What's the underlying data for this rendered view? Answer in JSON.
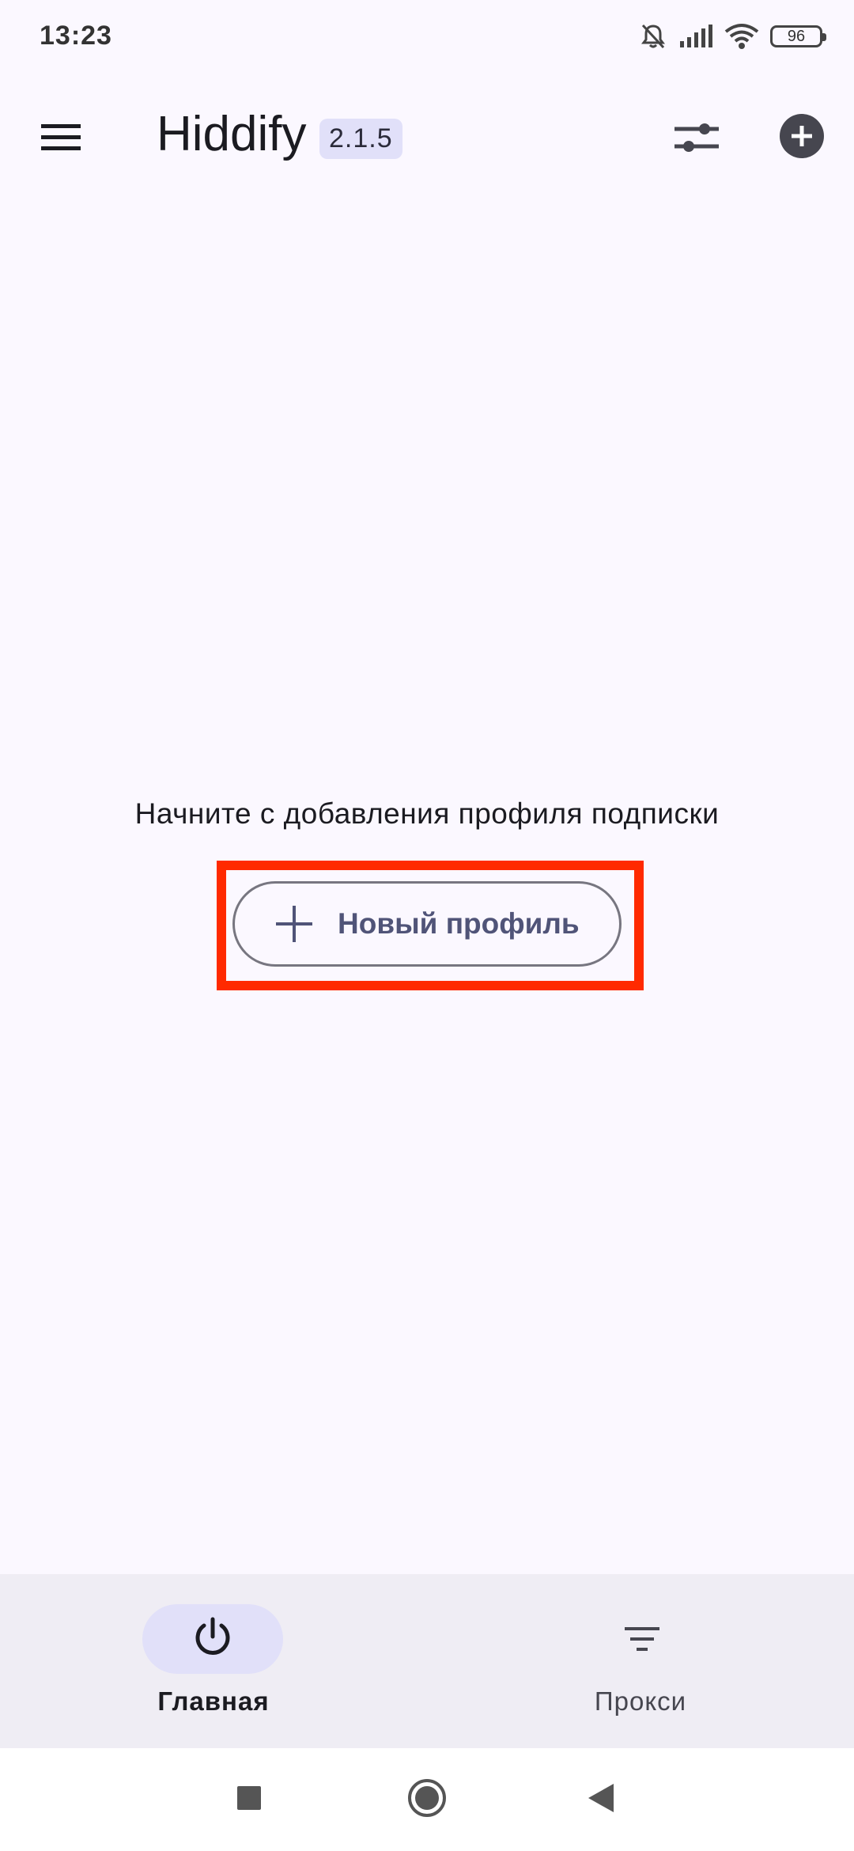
{
  "status_bar": {
    "time": "13:23",
    "battery": "96",
    "icons": [
      "bell-muted-icon",
      "signal-icon",
      "wifi-icon",
      "battery-icon"
    ]
  },
  "app_bar": {
    "title": "Hiddify",
    "version": "2.1.5",
    "icons": [
      "menu-icon",
      "filter-icon",
      "add-circle-icon"
    ]
  },
  "main": {
    "empty_message": "Начните с добавления профиля подписки",
    "new_profile_label": "Новый профиль"
  },
  "bottom_nav": {
    "items": [
      {
        "label": "Главная",
        "icon": "power-icon",
        "selected": true
      },
      {
        "label": "Прокси",
        "icon": "filter-list-icon",
        "selected": false
      }
    ]
  },
  "system_nav": {
    "icons": [
      "recents-icon",
      "home-icon",
      "back-icon"
    ]
  },
  "colors": {
    "background": "#fbf8ff",
    "accent_container": "#e1e0f9",
    "button_text": "#505478",
    "highlight": "#ff2a00",
    "nav_background": "#efedf4"
  }
}
